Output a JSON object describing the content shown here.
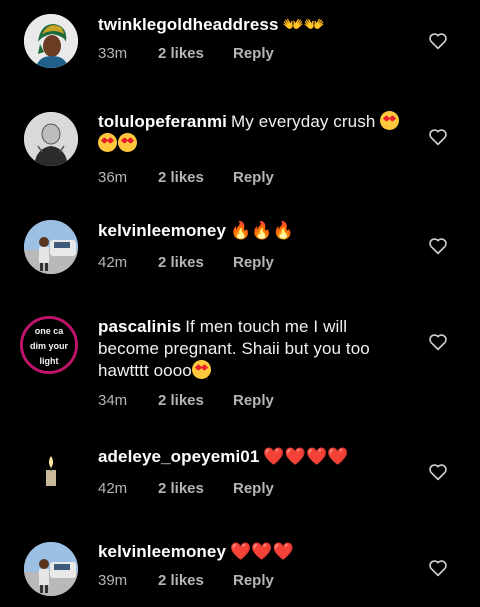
{
  "comments": [
    {
      "username": "twinklegoldheaddress",
      "text": "",
      "emojis": "👐👐",
      "time": "33m",
      "likes": "2 likes",
      "reply": "Reply",
      "avatar_icon": "avatar-woman-headwrap-icon"
    },
    {
      "username": "tolulopeferanmi",
      "text": "My everyday crush",
      "emojis": "😍😍😍",
      "time": "36m",
      "likes": "2 likes",
      "reply": "Reply",
      "avatar_icon": "avatar-sketch-portrait-icon"
    },
    {
      "username": "kelvinleemoney",
      "text": "",
      "emojis": "🔥🔥🔥",
      "time": "42m",
      "likes": "2 likes",
      "reply": "Reply",
      "avatar_icon": "avatar-man-car-icon"
    },
    {
      "username": "pascalinis",
      "text": "If men touch me I will become pregnant. Shaii but you too hawtttt oooo",
      "emojis": "😍",
      "time": "34m",
      "likes": "2 likes",
      "reply": "Reply",
      "avatar_icon": "avatar-text-ring-icon",
      "avatar_text": [
        "one ca",
        "dim your",
        "light"
      ]
    },
    {
      "username": "adeleye_opeyemi01",
      "text": "",
      "emojis": "❤️❤️❤️❤️",
      "time": "42m",
      "likes": "2 likes",
      "reply": "Reply",
      "avatar_icon": "avatar-candle-icon"
    },
    {
      "username": "kelvinleemoney",
      "text": "",
      "emojis": "❤️❤️❤️",
      "time": "39m",
      "likes": "2 likes",
      "reply": "Reply",
      "avatar_icon": "avatar-man-car-icon"
    }
  ],
  "colors": {
    "background": "#000000",
    "text": "#f0f0f0",
    "meta": "#b5b5b5",
    "heart_red": "#e8202a",
    "fire_orange": "#ff8a00"
  },
  "like_button_icon": "heart-outline-icon"
}
